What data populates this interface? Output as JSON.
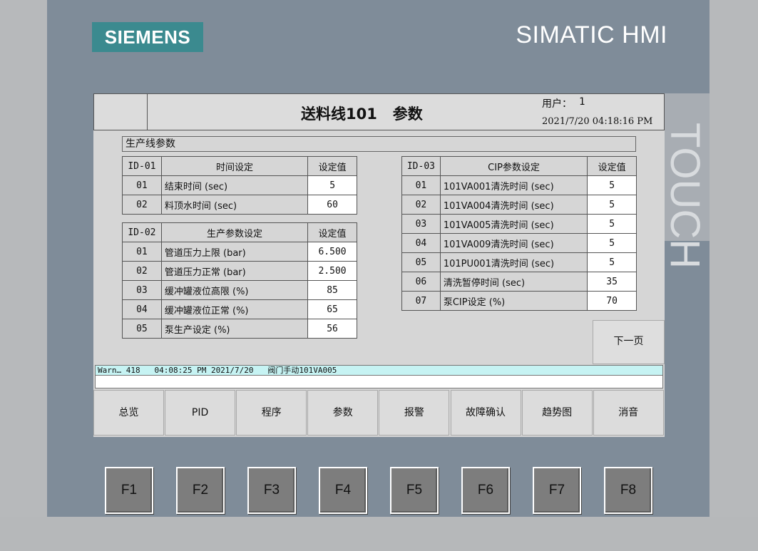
{
  "brand": {
    "logo": "SIEMENS",
    "product": "SIMATIC HMI",
    "touch": "TOUCH"
  },
  "header": {
    "title": "送料线101   参数",
    "user_label": "用户：",
    "user_value": "1",
    "datetime": "2021/7/20 04:18:16 PM"
  },
  "section_title": "生产线参数",
  "table1": {
    "headers": [
      "ID-01",
      "时间设定",
      "设定值"
    ],
    "rows": [
      [
        "01",
        "结束时间 (sec)",
        "5"
      ],
      [
        "02",
        "料顶水时间 (sec)",
        "60"
      ]
    ]
  },
  "table2": {
    "headers": [
      "ID-02",
      "生产参数设定",
      "设定值"
    ],
    "rows": [
      [
        "01",
        "管道压力上限 (bar)",
        "6.500"
      ],
      [
        "02",
        "管道压力正常 (bar)",
        "2.500"
      ],
      [
        "03",
        "缓冲罐液位高限 (%)",
        "85"
      ],
      [
        "04",
        "缓冲罐液位正常 (%)",
        "65"
      ],
      [
        "05",
        "泵生产设定 (%)",
        "56"
      ]
    ]
  },
  "table3": {
    "headers": [
      "ID-03",
      "CIP参数设定",
      "设定值"
    ],
    "rows": [
      [
        "01",
        "101VA001清洗时间 (sec)",
        "5"
      ],
      [
        "02",
        "101VA004清洗时间 (sec)",
        "5"
      ],
      [
        "03",
        "101VA005清洗时间 (sec)",
        "5"
      ],
      [
        "04",
        "101VA009清洗时间 (sec)",
        "5"
      ],
      [
        "05",
        "101PU001清洗时间 (sec)",
        "5"
      ],
      [
        "06",
        "清洗暂停时间 (sec)",
        "35"
      ],
      [
        "07",
        "泵CIP设定 (%)",
        "70"
      ]
    ]
  },
  "next_page": "下一页",
  "alarm": {
    "text": "Warn… 418   04:08:25 PM 2021/7/20   阀门手动101VA005"
  },
  "nav": [
    "总览",
    "PID",
    "程序",
    "参数",
    "报警",
    "故障确认",
    "趋势图",
    "消音"
  ],
  "fkeys": [
    "F1",
    "F2",
    "F3",
    "F4",
    "F5",
    "F6",
    "F7",
    "F8"
  ],
  "colors": {
    "bezel": "#7f8c99",
    "logo": "#3b8a8f",
    "alarm_bg": "#c6f3f3",
    "screen": "#d6d6d6"
  }
}
